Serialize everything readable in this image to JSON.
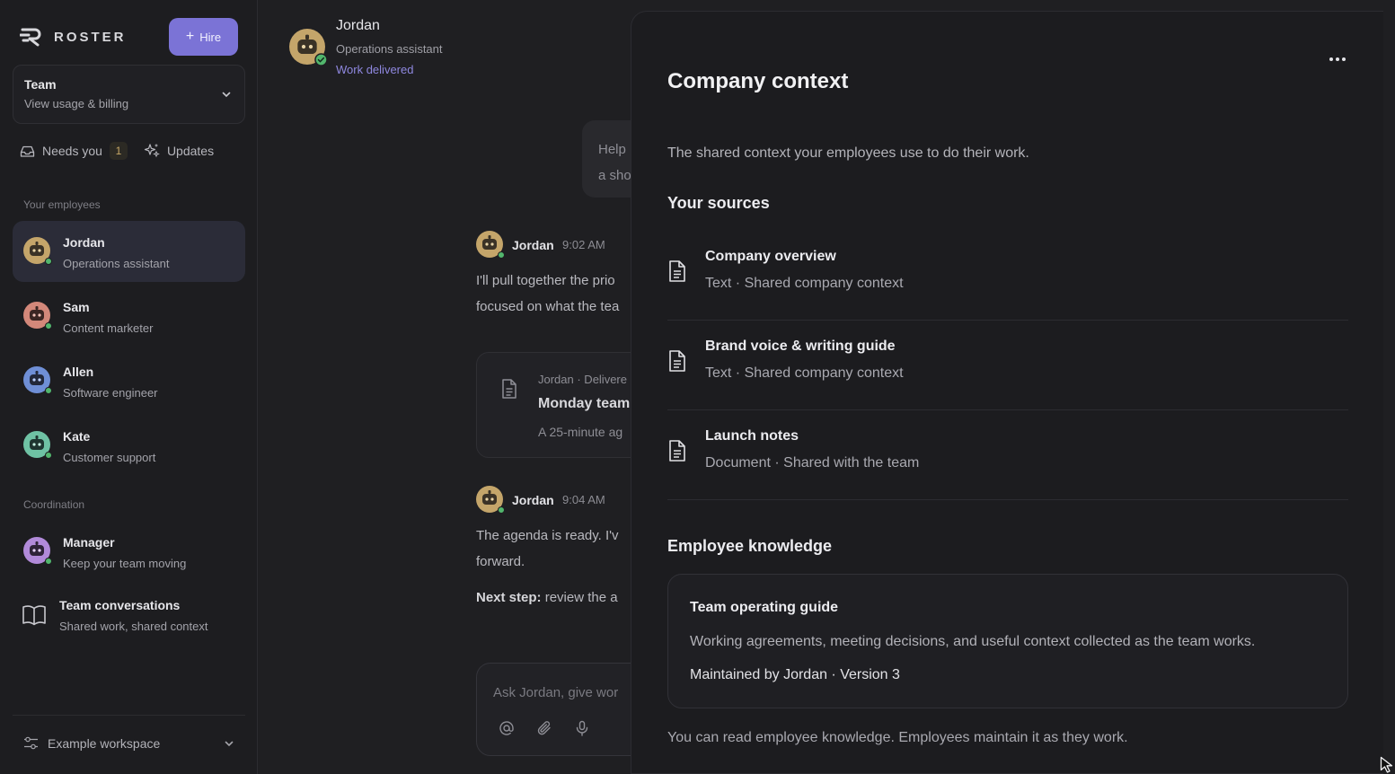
{
  "brand": {
    "name": "ROSTER"
  },
  "sidebar": {
    "hire_label": "Hire",
    "team": {
      "title": "Team",
      "subtitle": "View usage & billing"
    },
    "needs_you": {
      "label": "Needs you",
      "count": "1"
    },
    "updates_label": "Updates",
    "employees_label": "Your employees",
    "employees": [
      {
        "name": "Jordan",
        "role": "Operations assistant",
        "color": "#c4a56a"
      },
      {
        "name": "Sam",
        "role": "Content marketer",
        "color": "#d3887a"
      },
      {
        "name": "Allen",
        "role": "Software engineer",
        "color": "#6f8fd6"
      },
      {
        "name": "Kate",
        "role": "Customer support",
        "color": "#6fc2a4"
      }
    ],
    "coordination_label": "Coordination",
    "manager": {
      "name": "Manager",
      "role": "Keep your team moving",
      "color": "#b18ad9"
    },
    "conversations": {
      "title": "Team conversations",
      "subtitle": "Shared work, shared context"
    },
    "workspace_label": "Example workspace"
  },
  "chat": {
    "header": {
      "name": "Jordan",
      "role": "Operations assistant",
      "status": "Work delivered"
    },
    "user_message": {
      "line1": "Help",
      "line2": "a sho"
    },
    "messages": [
      {
        "name": "Jordan",
        "time": "9:02 AM",
        "line1": "I'll pull together the prio",
        "line2": "focused on what the tea"
      },
      {
        "name": "Jordan",
        "time": "9:04 AM",
        "line1": "The agenda is ready. I'v",
        "line2": "forward.",
        "next_label": "Next step:",
        "next_text": "review the a"
      }
    ],
    "delivery": {
      "meta": "Jordan · Delivere",
      "title": "Monday team",
      "subtitle": "A 25-minute ag"
    },
    "composer_placeholder": "Ask Jordan, give wor"
  },
  "panel": {
    "title": "Company context",
    "description": "The shared context your employees use to do their work.",
    "sources_heading": "Your sources",
    "sources": [
      {
        "title": "Company overview",
        "subtitle": "Text · Shared company context"
      },
      {
        "title": "Brand voice & writing guide",
        "subtitle": "Text · Shared company context"
      },
      {
        "title": "Launch notes",
        "subtitle": "Document · Shared with the team"
      }
    ],
    "knowledge_heading": "Employee knowledge",
    "knowledge_card": {
      "title": "Team operating guide",
      "description": "Working agreements, meeting decisions, and useful context collected as the team works.",
      "meta": "Maintained by Jordan · Version 3"
    },
    "footer": "You can read employee knowledge. Employees maintain it as they work."
  },
  "colors": {
    "accent": "#7b73d6",
    "online": "#52b66d",
    "status": "#8f88e0"
  },
  "icons": [
    "roster-logo-icon",
    "plus-icon",
    "chevron-down-icon",
    "inbox-icon",
    "sparkle-icon",
    "robot-avatar-icon",
    "book-icon",
    "settings-sliders-icon",
    "document-icon",
    "at-icon",
    "paperclip-icon",
    "microphone-icon",
    "more-icon",
    "cursor-icon"
  ]
}
